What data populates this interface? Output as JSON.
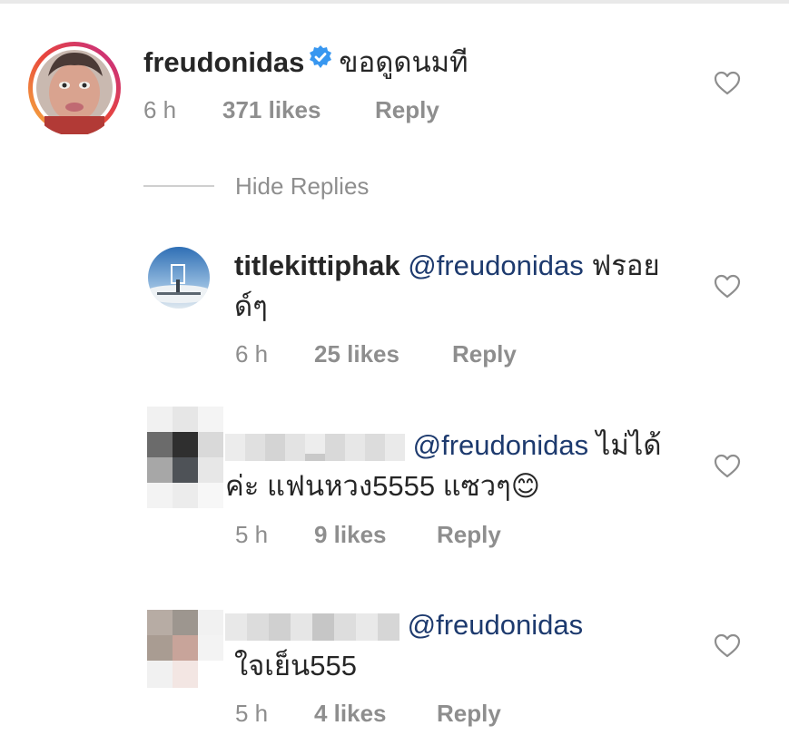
{
  "main_comment": {
    "username": "freudonidas",
    "text": "ขอดูดนมที",
    "time": "6 h",
    "likes": "371 likes",
    "reply": "Reply"
  },
  "hide_replies": "Hide Replies",
  "replies": [
    {
      "username": "titlekittiphak",
      "mention": "@freudonidas",
      "text_line1": "ฟรอย",
      "text_line2": "ด์ๆ",
      "time": "6 h",
      "likes": "25 likes",
      "reply": "Reply"
    },
    {
      "mention": "@freudonidas",
      "text_line1": "ไม่ได้",
      "text_line2": "ค่ะ แฟนหวง5555 แซวๆ",
      "emoji": "😊",
      "time": "5 h",
      "likes": "9 likes",
      "reply": "Reply"
    },
    {
      "mention": "@freudonidas",
      "text_line2": "ใจเย็น555",
      "time": "5 h",
      "likes": "4 likes",
      "reply": "Reply"
    }
  ],
  "colors": {
    "text": "#262626",
    "secondary": "#8e8e8e",
    "mention": "#1d3a6e",
    "verified": "#3897f0",
    "heart_outline": "#8e8e8e"
  },
  "icons": [
    "verified-badge-icon",
    "heart-icon"
  ]
}
